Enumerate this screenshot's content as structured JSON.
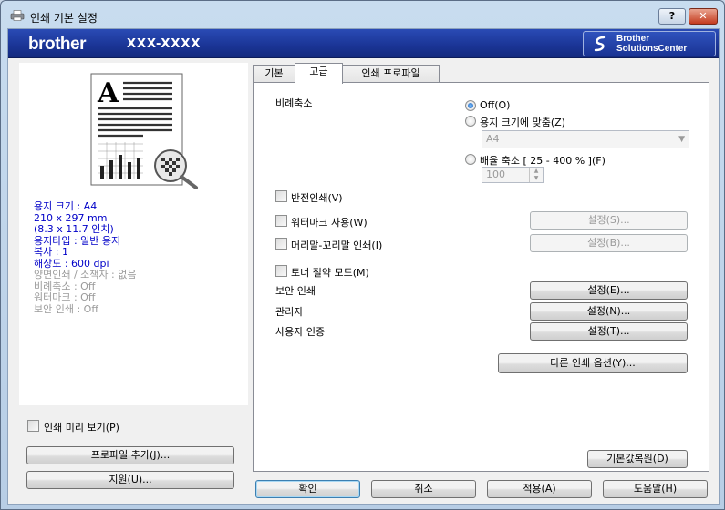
{
  "window": {
    "title": "인쇄 기본 설정",
    "help_label": "?",
    "close_label": "✕"
  },
  "brand": {
    "logo": "brother",
    "model": "XXX-XXXX",
    "solutions_line1": "Brother",
    "solutions_line2": "SolutionsCenter",
    "bar_color": "#1a3495"
  },
  "left": {
    "info_on": [
      "용지 크기 : A4",
      "210 x 297 mm",
      "(8.3 x 11.7 인치)",
      "용지타입 : 일반 용지",
      "복사 : 1",
      "해상도 : 600 dpi"
    ],
    "info_off": [
      "양면인쇄 / 소책자 : 없음",
      "비례축소 : Off",
      "워터마크 : Off",
      "보안 인쇄 : Off"
    ],
    "print_preview_label": "인쇄 미리 보기(P)",
    "add_profile_label": "프로파일 추가(J)...",
    "support_label": "지원(U)..."
  },
  "tabs": [
    "기본",
    "고급",
    "인쇄 프로파일"
  ],
  "active_tab": "고급",
  "advanced": {
    "scaling_label": "비례축소",
    "scaling_off_label": "Off(O)",
    "fit_to_paper_label": "용지 크기에 맞춤(Z)",
    "paper_size_value": "A4",
    "free_scale_label": "배율 축소 [ 25 - 400 % ](F)",
    "free_scale_value": "100",
    "reverse_print_label": "반전인쇄(V)",
    "watermark_label": "워터마크 사용(W)",
    "watermark_settings_label": "설정(S)...",
    "header_footer_label": "머리말-꼬리말 인쇄(I)",
    "header_footer_settings_label": "설정(B)...",
    "toner_save_label": "토너 절약 모드(M)",
    "secure_print_label": "보안 인쇄",
    "secure_print_settings_label": "설정(E)...",
    "administrator_label": "관리자",
    "administrator_settings_label": "설정(N)...",
    "user_auth_label": "사용자 인증",
    "user_auth_settings_label": "설정(T)...",
    "other_options_label": "다른 인쇄 옵션(Y)...",
    "default_label": "기본값복원(D)"
  },
  "footer": {
    "ok_label": "확인",
    "cancel_label": "취소",
    "apply_label": "적용(A)",
    "help_label": "도움말(H)"
  }
}
